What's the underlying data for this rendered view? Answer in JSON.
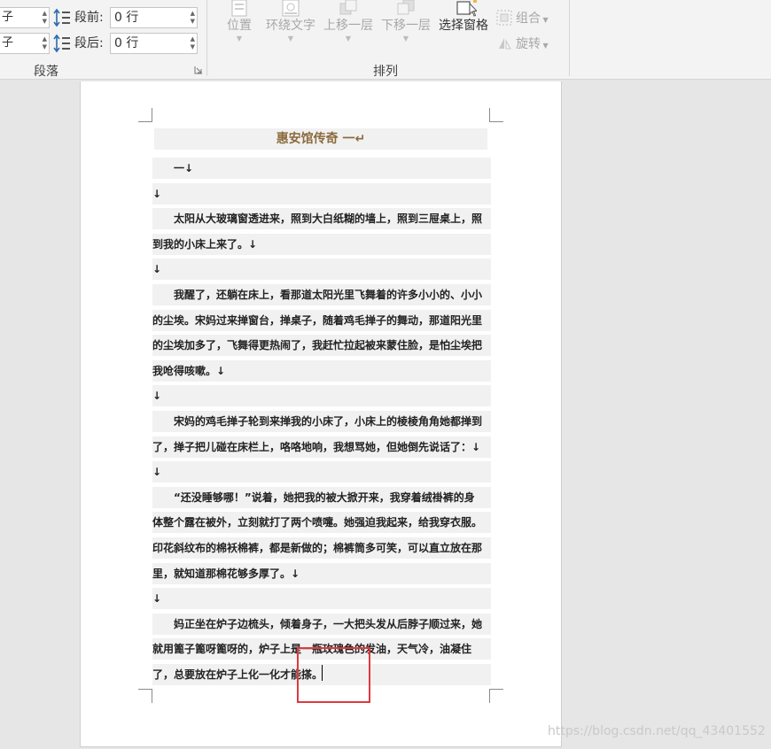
{
  "paragraph_group": {
    "label": "段落",
    "before_label": "段前:",
    "before_value": "0 行",
    "after_label": "段后:",
    "after_value": "0 行",
    "left_value_top": "子",
    "left_value_bottom": "子"
  },
  "arrange_group": {
    "label": "排列",
    "position": "位置",
    "wrap_text": "环绕文字",
    "bring_forward": "上移一层",
    "send_backward": "下移一层",
    "selection_pane": "选择窗格",
    "group": "组合",
    "rotate": "旋转"
  },
  "document": {
    "title": "惠安馆传奇 一↵",
    "lines": [
      {
        "text": "一↓",
        "indent": true
      },
      {
        "text": "↓",
        "indent": false
      },
      {
        "text": "太阳从大玻璃窗透进来，照到大白纸糊的墙上，照到三屉桌上，照",
        "indent": true
      },
      {
        "text": "到我的小床上来了。↓",
        "indent": false
      },
      {
        "text": "↓",
        "indent": false
      },
      {
        "text": "我醒了，还躺在床上，看那道太阳光里飞舞着的许多小小的、小小",
        "indent": true
      },
      {
        "text": "的尘埃。宋妈过来掸窗台，掸桌子，随着鸡毛掸子的舞动，那道阳光里",
        "indent": false
      },
      {
        "text": "的尘埃加多了，飞舞得更热闹了，我赶忙拉起被来蒙住脸，是怕尘埃把",
        "indent": false
      },
      {
        "text": "我呛得咳嗽。↓",
        "indent": false
      },
      {
        "text": "↓",
        "indent": false
      },
      {
        "text": "宋妈的鸡毛掸子轮到来掸我的小床了，小床上的棱棱角角她都掸到",
        "indent": true
      },
      {
        "text": "了，掸子把儿碰在床栏上，咯咯地响，我想骂她，但她倒先说话了：↓",
        "indent": false
      },
      {
        "text": "↓",
        "indent": false
      },
      {
        "text": "“还没睡够哪！”说着，她把我的被大掀开来，我穿着绒褂裤的身",
        "indent": true
      },
      {
        "text": "体整个露在被外，立刻就打了两个喷嚏。她强迫我起来，给我穿衣服。",
        "indent": false
      },
      {
        "text": "印花斜纹布的棉袄棉裤，都是新做的；棉裤筒多可笑，可以直立放在那",
        "indent": false
      },
      {
        "text": "里，就知道那棉花够多厚了。↓",
        "indent": false
      },
      {
        "text": "↓",
        "indent": false
      },
      {
        "text": "妈正坐在炉子边梳头，倾着身子，一大把头发从后脖子顺过来，她",
        "indent": true
      },
      {
        "text": "就用篦子篦呀篦呀的，炉子上是一瓶玫瑰色的发油，天气冷，油凝住",
        "indent": false
      },
      {
        "text": "了，总要放在炉子上化一化才能搽。",
        "indent": false
      }
    ]
  },
  "watermark": "https://blog.csdn.net/qq_43401552",
  "colors": {
    "highlight_box": "#e0393e",
    "title_text": "#8a6a3c",
    "line_shading": "#f1f1f1"
  }
}
